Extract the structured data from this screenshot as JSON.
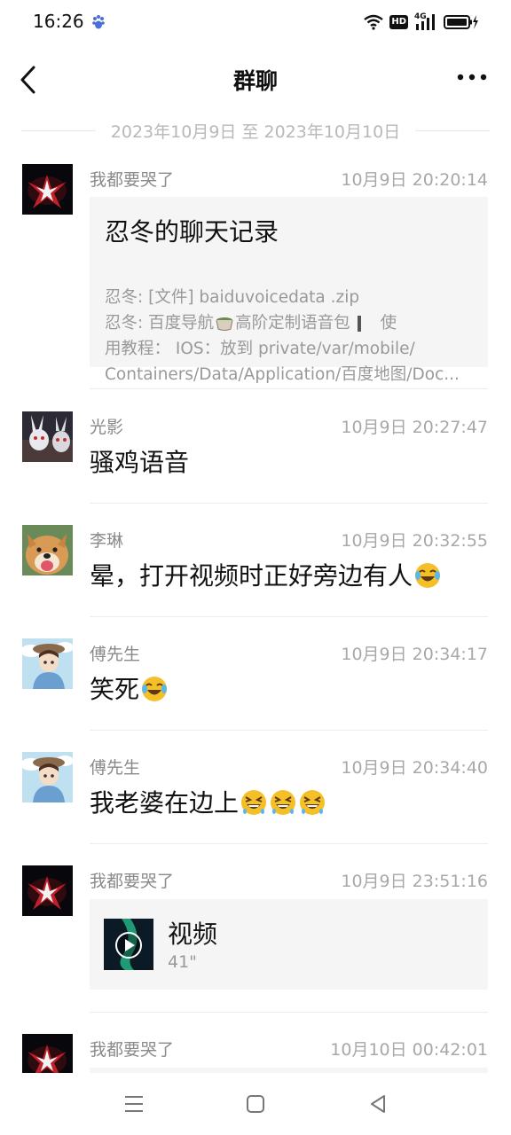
{
  "status": {
    "time": "16:26",
    "network": "4G",
    "hd": "HD"
  },
  "nav": {
    "title": "群聊",
    "back_icon": "chevron-left-icon",
    "more_icon": "more-dots-icon"
  },
  "date_range": "2023年10月9日 至 2023年10月10日",
  "messages": [
    {
      "sender": "我都要哭了",
      "time": "10月9日 20:20:14",
      "type": "record",
      "record": {
        "title": "忍冬的聊天记录",
        "line1": "忍冬: [文件] baiduvoicedata .zip",
        "line2_a": "忍冬: 百度导航",
        "line2_b": "高阶定制语音包",
        "line2_c": "使",
        "line3": "用教程： IOS：放到 private/var/mobile/",
        "line4": "Containers/Data/Application/百度地图/Doc..."
      }
    },
    {
      "sender": "光影",
      "time": "10月9日 20:27:47",
      "type": "text",
      "text": "骚鸡语音"
    },
    {
      "sender": "李琳",
      "time": "10月9日 20:32:55",
      "type": "text",
      "text": "晕，打开视频时正好旁边有人"
    },
    {
      "sender": "傅先生",
      "time": "10月9日 20:34:17",
      "type": "text",
      "text": "笑死"
    },
    {
      "sender": "傅先生",
      "time": "10月9日 20:34:40",
      "type": "text",
      "text": "我老婆在边上"
    },
    {
      "sender": "我都要哭了",
      "time": "10月9日 23:51:16",
      "type": "video",
      "video": {
        "title": "视频",
        "duration": "41\""
      }
    },
    {
      "sender": "我都要哭了",
      "time": "10月10日 00:42:01",
      "type": "partial"
    }
  ],
  "colors": {
    "meta": "#a8a8a8",
    "card_bg": "#f5f5f5",
    "divider": "#ececec",
    "emoji": "#f5c027"
  }
}
